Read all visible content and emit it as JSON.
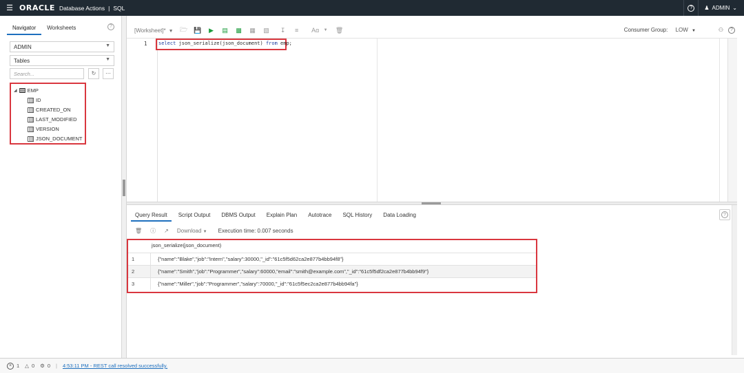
{
  "header": {
    "brand": "ORACLE",
    "app": "Database Actions",
    "separator": "|",
    "section": "SQL",
    "user": "ADMIN",
    "help_glyph": "?"
  },
  "left": {
    "tabs": [
      "Navigator",
      "Worksheets"
    ],
    "schema": "ADMIN",
    "object_type": "Tables",
    "search_placeholder": "Search...",
    "tree": {
      "table": "EMP",
      "columns": [
        "ID",
        "CREATED_ON",
        "LAST_MODIFIED",
        "VERSION",
        "JSON_DOCUMENT"
      ]
    }
  },
  "toolbar": {
    "worksheet": "[Worksheet]*",
    "consumer_group_label": "Consumer Group:",
    "consumer_group_value": "LOW",
    "font_glyph": "Aɑ"
  },
  "editor": {
    "line_number": "1",
    "kw_select": "select",
    "middle": " json_serialize(json_document) ",
    "kw_from": "from",
    "end": " emp;"
  },
  "results": {
    "tabs": [
      "Query Result",
      "Script Output",
      "DBMS Output",
      "Explain Plan",
      "Autotrace",
      "SQL History",
      "Data Loading"
    ],
    "download_label": "Download",
    "exec_time": "Execution time: 0.007 seconds",
    "column_header": "json_serialize(json_document)",
    "rows": [
      {
        "num": "1",
        "value": "{\"name\":\"Blake\",\"job\":\"Intern\",\"salary\":30000,\"_id\":\"61c5f5d62ca2e877b4bb94f8\"}"
      },
      {
        "num": "2",
        "value": "{\"name\":\"Smith\",\"job\":\"Programmer\",\"salary\":60000,\"email\":\"smith@example.com\",\"_id\":\"61c5f5df2ca2e877b4bb94f9\"}"
      },
      {
        "num": "3",
        "value": "{\"name\":\"Miller\",\"job\":\"Programmer\",\"salary\":70000,\"_id\":\"61c5f5ec2ca2e877b4bb94fa\"}"
      }
    ]
  },
  "status": {
    "errors": "1",
    "warnings": "0",
    "jobs": "0",
    "message": "4:53:11 PM - REST call resolved successfully."
  },
  "colors": {
    "header_bg": "#202a33",
    "accent": "#1d6fbe",
    "highlight": "#d9363e",
    "run": "#1a9b3b"
  }
}
